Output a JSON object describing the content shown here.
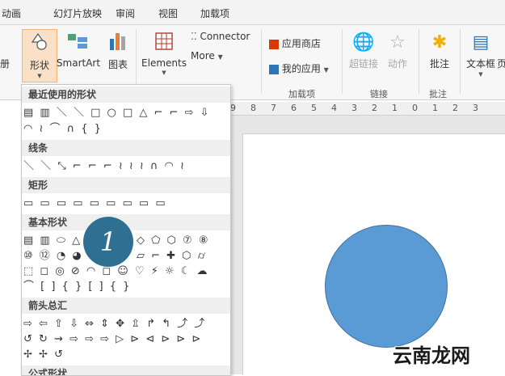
{
  "tabs": [
    "动画",
    "幻灯片放映",
    "审阅",
    "视图",
    "加载项"
  ],
  "ribbon": {
    "left_cut": "册",
    "shapes": "形状",
    "smartart": "SmartArt",
    "chart": "图表",
    "elements": "Elements",
    "connector": "Connector",
    "more": "More",
    "app_store": "应用商店",
    "my_apps": "我的应用",
    "hyperlink": "超链接",
    "action": "动作",
    "comment": "批注",
    "textbox": "文本框",
    "right_cut": "页"
  },
  "groups": {
    "addins": "加载项",
    "links": "链接",
    "comments": "批注"
  },
  "ruler": [
    "9",
    "8",
    "7",
    "6",
    "5",
    "4",
    "3",
    "2",
    "1",
    "0",
    "1",
    "2",
    "3"
  ],
  "shapes_panel": {
    "sections": [
      {
        "title": "最近使用的形状",
        "rows": [
          "▤ ▥ ＼ ＼ □ ○ □ △ ⌐ ⌐ ⇨ ⇩",
          "◠ ≀ ⌒ ∩ {   }"
        ]
      },
      {
        "title": "线条",
        "rows": [
          "＼ ＼ ⤡ ⌐ ⌐ ⌐ ≀ ≀ ≀ ∩ ◠ ≀"
        ]
      },
      {
        "title": "矩形",
        "rows": [
          "▭ ▭ ▭ ▭ ▭ ▭ ▭ ▭ ▭"
        ]
      },
      {
        "title": "基本形状",
        "rows": [
          "▤ ▥ ⬭ △",
          "⑩ ⑫ ◔ ◕",
          "⬚ ◻ ◎ ⊘ ◠ ◻ ☺ ♡ ⚡ ☼ ☾ ☁",
          "⌒ [ ] { } [  ] {  }"
        ]
      },
      {
        "title": "箭头总汇",
        "rows": [
          "⇨ ⇦ ⇧ ⇩ ⇔ ⇕ ✥ ⇫ ↱ ↰ ⤴ ⤴",
          "↺ ↻ ⇝ ⇨ ⇨ ⇨ ▷ ⊳ ⊲ ⊳ ⊳ ⊳",
          "✢ ✢ ↺"
        ]
      },
      {
        "title": "公式形状",
        "rows": []
      }
    ],
    "basic_right": "◇ ⬠ ⬡ ⑦ ⑧",
    "basic_right2": "▱ ⌐ ✚ ⬡ ⌭"
  },
  "callout_number": "1",
  "watermark": "云南龙网",
  "colors": {
    "circle": "#5b9bd5",
    "callout": "#2f6f91",
    "panel_header": "#efefef"
  }
}
